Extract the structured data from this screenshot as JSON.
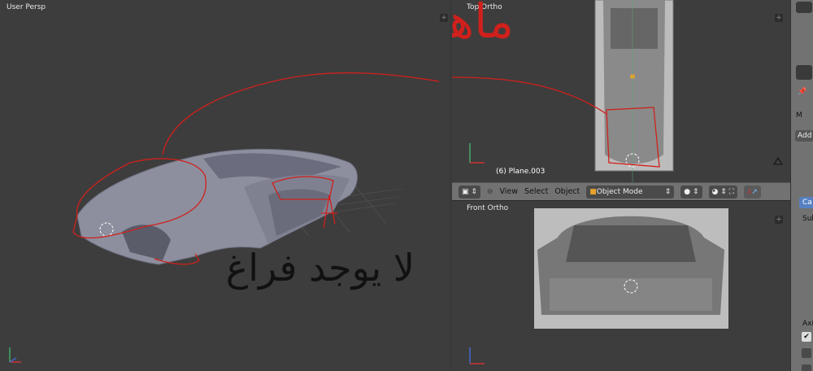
{
  "viewports": {
    "user_persp": {
      "label": "User Persp"
    },
    "top_ortho": {
      "label": "Top Ortho",
      "object_info": "(6) Plane.003"
    },
    "front_ortho": {
      "label": "Front Ortho"
    }
  },
  "header": {
    "menu": [
      "View",
      "Select",
      "Object"
    ],
    "mode": "Object Mode"
  },
  "properties": {
    "section": "M",
    "add_label": "Add",
    "ca_label": "Ca",
    "sub_label": "Sub",
    "axis_label": "Axi"
  },
  "annotations": {
    "top": "ماهذا",
    "bottom": "لا يوجد فراغ"
  },
  "colors": {
    "annotation_red": "#d0201c",
    "annotation_black": "#111111",
    "accent_blue": "#5680c2"
  }
}
